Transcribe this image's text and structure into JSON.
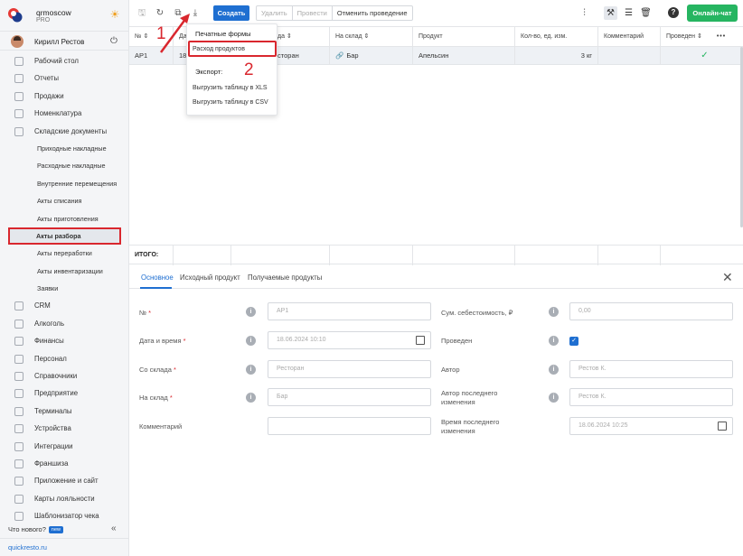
{
  "colors": {
    "accent": "#1f6fd1",
    "chat": "#26b561",
    "annotation": "#d9272e"
  },
  "brand": {
    "name": "qrmoscow",
    "plan": "PRO"
  },
  "user": {
    "name": "Кирилл Рестов"
  },
  "nav": {
    "items": [
      "Рабочий стол",
      "Отчеты",
      "Продажи",
      "Номенклатура",
      "Складские документы"
    ],
    "sub": [
      "Приходные накладные",
      "Расходные накладные",
      "Внутренние перемещения",
      "Акты списания",
      "Акты приготовления",
      "Акты разбора",
      "Акты переработки",
      "Акты инвентаризации",
      "Заявки"
    ],
    "items2": [
      "CRM",
      "Алкоголь",
      "Финансы",
      "Персонал",
      "Справочники",
      "Предприятие",
      "Терминалы",
      "Устройства",
      "Интеграции",
      "Франшиза",
      "Приложение и сайт",
      "Карты лояльности",
      "Шаблонизатор чека"
    ]
  },
  "whats_new": "Что нового?",
  "new_badge": "new",
  "site": "quickresto.ru",
  "toolbar": {
    "create": "Создать",
    "delete": "Удалить",
    "post": "Провести",
    "unpost": "Отменить проведение",
    "chat": "Онлайн-чат"
  },
  "grid": {
    "headers": [
      "№",
      "Да",
      "да",
      "На склад",
      "Продукт",
      "Кол-во, ед. изм.",
      "Комментарий",
      "Проведен"
    ],
    "row": {
      "num": "АР1",
      "date": "18",
      "from": "сторан",
      "to": "Бар",
      "product": "Апельсин",
      "qty": "3 кг",
      "comment": "",
      "posted": "✓"
    },
    "total_label": "ИТОГО:"
  },
  "dropdown": {
    "print_forms": "Печатные формы",
    "product_expense": "Расход продуктов",
    "export": "Экспорт:",
    "xls": "Выгрузить таблицу в XLS",
    "csv": "Выгрузить таблицу в CSV"
  },
  "annotations": {
    "one": "1",
    "two": "2"
  },
  "detail": {
    "tabs": [
      "Основное",
      "Исходный продукт",
      "Получаемые продукты"
    ],
    "left": [
      {
        "label": "№",
        "required": "*",
        "value": "АР1"
      },
      {
        "label": "Дата и время",
        "required": "*",
        "value": "18.06.2024 10:10"
      },
      {
        "label": "Со склада",
        "required": "*",
        "value": "Ресторан"
      },
      {
        "label": "На склад",
        "required": "*",
        "value": "Бар"
      },
      {
        "label": "Комментарий",
        "required": "",
        "value": ""
      }
    ],
    "right": [
      {
        "label": "Сум. себестоимость, ₽",
        "value": "0,00"
      },
      {
        "label": "Проведен",
        "value": "✓"
      },
      {
        "label": "Автор",
        "value": "Рестов К."
      },
      {
        "label_line1": "Автор последнего",
        "label_line2": "изменения",
        "value": "Рестов К."
      },
      {
        "label_line1": "Время последнего",
        "label_line2": "изменения",
        "value": "18.06.2024 10:25"
      }
    ]
  }
}
